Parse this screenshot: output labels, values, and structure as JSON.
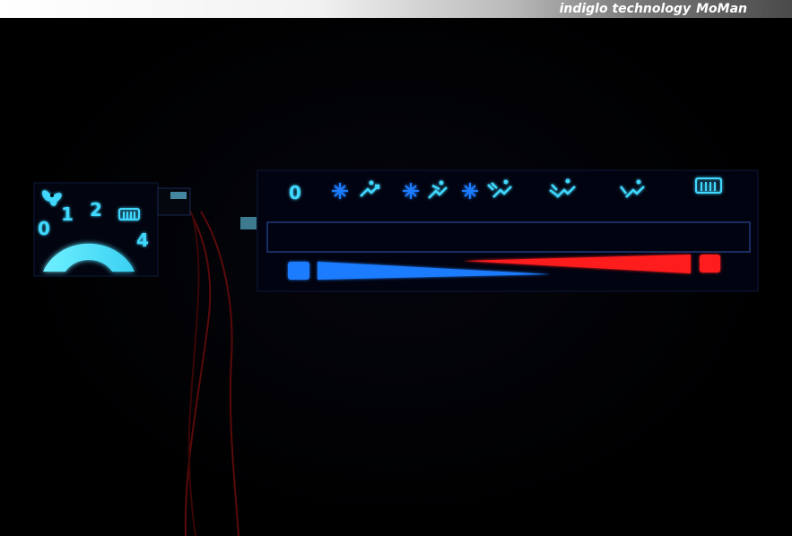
{
  "header": {
    "brand_text": "indiglo technology",
    "brand_name": "MoMan",
    "bar_color": "#ffffff"
  },
  "fan_dial": {
    "icon": "fan-icon",
    "labels": [
      "0",
      "1",
      "2",
      "4"
    ],
    "defrost_icon": "rear-defrost-icon",
    "color": "#3fd8ff"
  },
  "climate_panel": {
    "off_label": "0",
    "mode_icons": [
      "ac-snowflake-face-vent-icon",
      "ac-snowflake-face-feet-vent-icon",
      "ac-snowflake-feet-vent-icon",
      "face-feet-vent-icon",
      "feet-vent-icon",
      "rear-defrost-icon"
    ],
    "cold_color": "#1e7bff",
    "hot_color": "#ff1a1a"
  }
}
